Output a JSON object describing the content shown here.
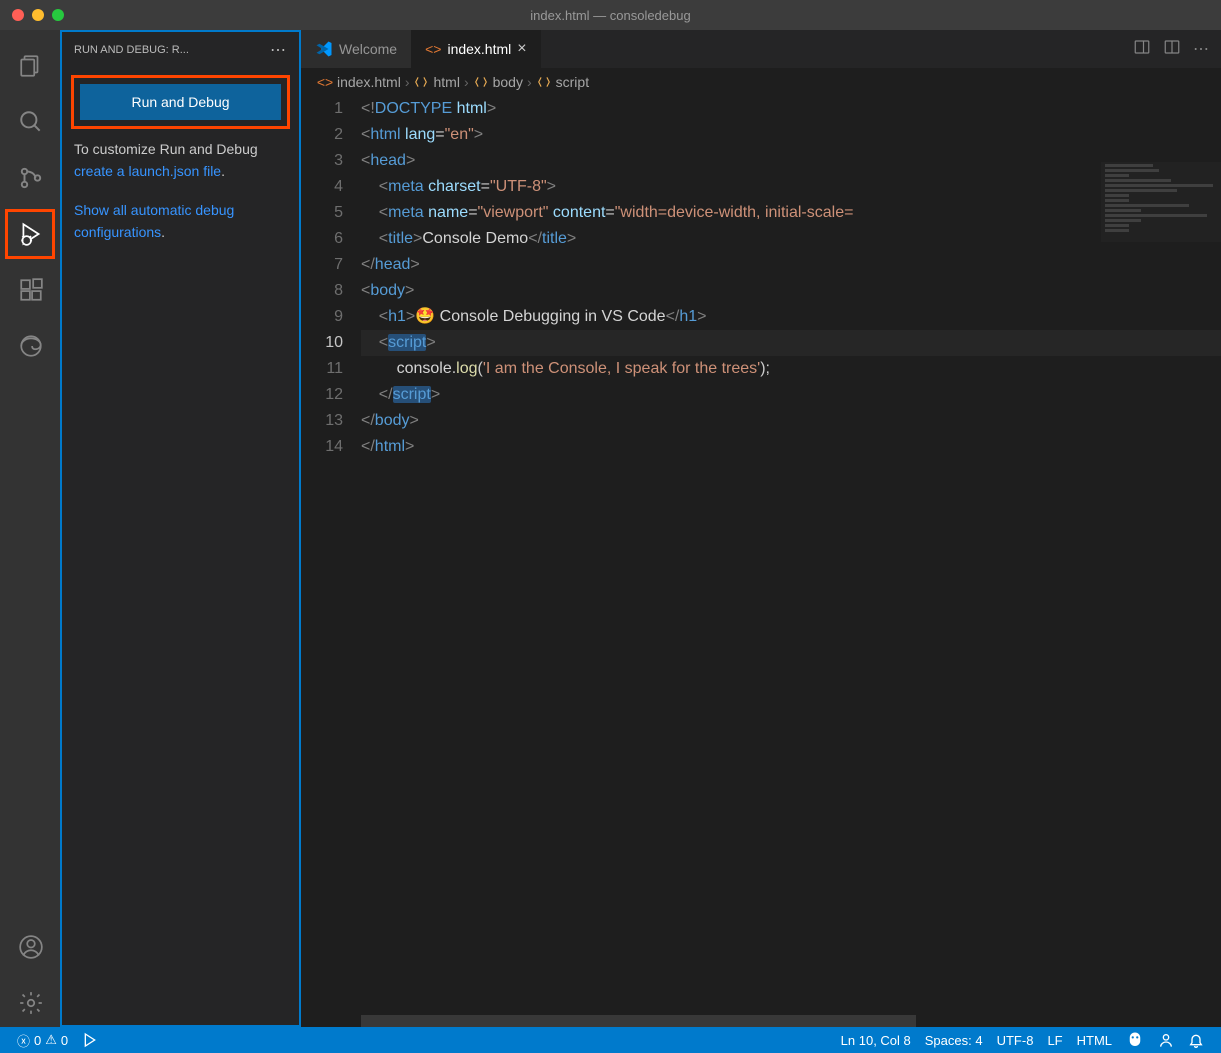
{
  "window": {
    "title": "index.html — consoledebug"
  },
  "sidebar": {
    "header": "RUN AND DEBUG: R...",
    "run_button": "Run and Debug",
    "customize_pre": "To customize Run and Debug ",
    "customize_link": "create a launch.json file",
    "customize_post": ".",
    "show_link": "Show all automatic debug configurations",
    "show_post": "."
  },
  "tabs": {
    "welcome": "Welcome",
    "index": "index.html"
  },
  "breadcrumbs": [
    {
      "icon": "file-html",
      "label": "index.html"
    },
    {
      "icon": "tag",
      "label": "html"
    },
    {
      "icon": "tag",
      "label": "body"
    },
    {
      "icon": "tag",
      "label": "script"
    }
  ],
  "code": {
    "lines": [
      {
        "n": 1,
        "html": "<span class='t-doc'>&lt;!</span><span class='t-tag'>DOCTYPE</span> <span class='t-attr'>html</span><span class='t-doc'>&gt;</span>"
      },
      {
        "n": 2,
        "html": "<span class='t-doc'>&lt;</span><span class='t-tag'>html</span> <span class='t-attr'>lang</span>=<span class='t-str'>\"en\"</span><span class='t-doc'>&gt;</span>"
      },
      {
        "n": 3,
        "html": "<span class='t-doc'>&lt;</span><span class='t-tag'>head</span><span class='t-doc'>&gt;</span>"
      },
      {
        "n": 4,
        "html": "    <span class='t-doc'>&lt;</span><span class='t-tag'>meta</span> <span class='t-attr'>charset</span>=<span class='t-str'>\"UTF-8\"</span><span class='t-doc'>&gt;</span>"
      },
      {
        "n": 5,
        "html": "    <span class='t-doc'>&lt;</span><span class='t-tag'>meta</span> <span class='t-attr'>name</span>=<span class='t-str'>\"viewport\"</span> <span class='t-attr'>content</span>=<span class='t-str'>\"width=device-width, initial-scale=</span>"
      },
      {
        "n": 6,
        "html": "    <span class='t-doc'>&lt;</span><span class='t-tag'>title</span><span class='t-doc'>&gt;</span><span class='t-txt'>Console Demo</span><span class='t-doc'>&lt;/</span><span class='t-tag'>title</span><span class='t-doc'>&gt;</span>"
      },
      {
        "n": 7,
        "html": "<span class='t-doc'>&lt;/</span><span class='t-tag'>head</span><span class='t-doc'>&gt;</span>"
      },
      {
        "n": 8,
        "html": "<span class='t-doc'>&lt;</span><span class='t-tag'>body</span><span class='t-doc'>&gt;</span>"
      },
      {
        "n": 9,
        "html": "    <span class='t-doc'>&lt;</span><span class='t-tag'>h1</span><span class='t-doc'>&gt;</span><span class='t-txt'>🤩 Console Debugging in VS Code</span><span class='t-doc'>&lt;/</span><span class='t-tag'>h1</span><span class='t-doc'>&gt;</span>"
      },
      {
        "n": 10,
        "html": "    <span class='t-doc'>&lt;</span><span class='t-tag hl-sel'>script</span><span class='t-doc'>&gt;</span>",
        "cur": true
      },
      {
        "n": 11,
        "html": "        <span class='t-txt'>console</span>.<span class='t-fn'>log</span>(<span class='t-str'>'I am the Console, I speak for the trees'</span>);"
      },
      {
        "n": 12,
        "html": "    <span class='t-doc'>&lt;/</span><span class='t-tag hl-sel'>script</span><span class='t-doc'>&gt;</span>"
      },
      {
        "n": 13,
        "html": "<span class='t-doc'>&lt;/</span><span class='t-tag'>body</span><span class='t-doc'>&gt;</span>"
      },
      {
        "n": 14,
        "html": "<span class='t-doc'>&lt;/</span><span class='t-tag'>html</span><span class='t-doc'>&gt;</span>"
      }
    ]
  },
  "status": {
    "errors": "0",
    "warnings": "0",
    "cursor": "Ln 10, Col 8",
    "spaces": "Spaces: 4",
    "encoding": "UTF-8",
    "eol": "LF",
    "lang": "HTML"
  }
}
